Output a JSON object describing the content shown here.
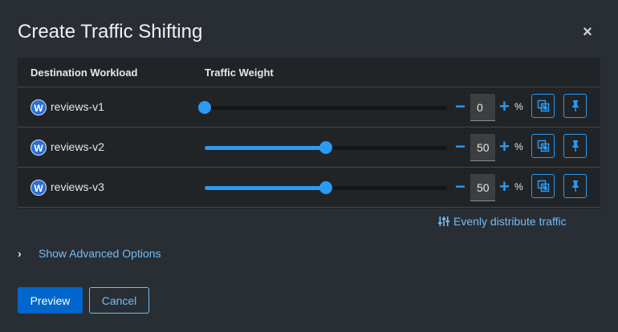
{
  "dialog": {
    "title": "Create Traffic Shifting",
    "close_icon": "close-icon"
  },
  "table": {
    "headers": [
      "Destination Workload",
      "Traffic Weight"
    ],
    "rows": [
      {
        "badge": "W",
        "name": "reviews-v1",
        "weight": 0,
        "value": "0",
        "unit": "%"
      },
      {
        "badge": "W",
        "name": "reviews-v2",
        "weight": 50,
        "value": "50",
        "unit": "%"
      },
      {
        "badge": "W",
        "name": "reviews-v3",
        "weight": 50,
        "value": "50",
        "unit": "%"
      }
    ]
  },
  "actions": {
    "evenly_distribute": "Evenly distribute traffic",
    "advanced_options": "Show Advanced Options",
    "preview": "Preview",
    "cancel": "Cancel"
  },
  "colors": {
    "accent": "#2b9af3",
    "link": "#73bcf7",
    "primary_button": "#0066cc",
    "background": "#292e34",
    "table_background": "#212427"
  }
}
